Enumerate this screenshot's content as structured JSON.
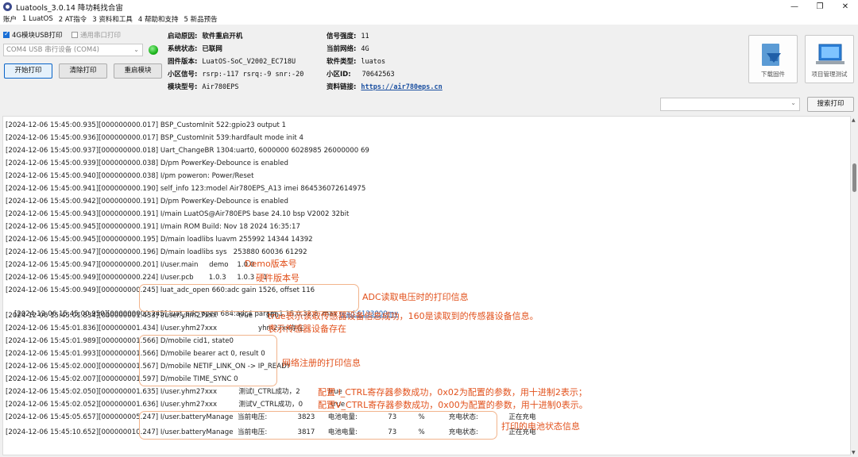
{
  "window": {
    "title": "Luatools_3.0.14 降功耗找合宙",
    "min_glyph": "—",
    "max_glyph": "❐",
    "close_glyph": "✕"
  },
  "menu": [
    "账户",
    "1 LuatOS",
    "2 AT指令",
    "3 资料和工具",
    "4 帮助和支持",
    "5 新品预告"
  ],
  "options": {
    "usb_print_label": "4G模块USB打印",
    "usb_print_checked": true,
    "serial_print_label": "通用串口打印",
    "serial_print_checked": false
  },
  "port_select": {
    "value": "COM4 USB 串行设备 (COM4)"
  },
  "led_color": "#1db41d",
  "buttons": {
    "start_print": "开始打印",
    "clear_print": "清除打印",
    "restart_module": "重启模块",
    "download_firmware": "下载固件",
    "project_test": "项目管理测试",
    "search_print": "搜索打印"
  },
  "device_info": {
    "boot_reason_label": "启动原因:",
    "boot_reason": "软件重启开机",
    "system_status_label": "系统状态:",
    "system_status": "已联网",
    "firmware_label": "固件版本:",
    "firmware": "LuatOS-SoC_V2002_EC718U",
    "cell_signal_label": "小区信号:",
    "cell_signal": "rsrp:-117 rsrq:-9 snr:-20",
    "module_model_label": "模块型号:",
    "module_model": "Air780EPS",
    "signal_label": "信号强度:",
    "signal": "11",
    "network_label": "当前网络:",
    "network": "4G",
    "sw_type_label": "软件类型:",
    "sw_type": "luatos",
    "cell_id_label": "小区ID:",
    "cell_id": "70642563",
    "docs_label": "资料链接:",
    "docs_link": "https://air780eps.cn"
  },
  "log": [
    "[2024-12-06 15:45:00.935][000000000.017] BSP_CustomInit 522:gpio23 output 1",
    "[2024-12-06 15:45:00.936][000000000.017] BSP_CustomInit 539:hardfault mode init 4",
    "[2024-12-06 15:45:00.937][000000000.018] Uart_ChangeBR 1304:uart0, 6000000 6028985 26000000 69",
    "[2024-12-06 15:45:00.939][000000000.038] D/pm PowerKey-Debounce is enabled",
    "[2024-12-06 15:45:00.940][000000000.038] I/pm poweron: Power/Reset",
    "[2024-12-06 15:45:00.941][000000000.190] self_info 123:model Air780EPS_A13 imei 864536072614975",
    "[2024-12-06 15:45:00.942][000000000.191] D/pm PowerKey-Debounce is enabled",
    "[2024-12-06 15:45:00.943][000000000.191] I/main LuatOS@Air780EPS base 24.10 bsp V2002 32bit",
    "[2024-12-06 15:45:00.945][000000000.191] I/main ROM Build: Nov 18 2024 16:35:17",
    "[2024-12-06 15:45:00.945][000000000.195] D/main loadlibs luavm 255992 14344 14392",
    "[2024-12-06 15:45:00.947][000000000.196] D/main loadlibs sys   253880 60036 61292",
    "[2024-12-06 15:45:00.947][000000000.201] I/user.main     demo    1.0.0",
    "[2024-12-06 15:45:00.949][000000000.224] I/user.pcb       1.0.3     1.0.3    1",
    "[2024-12-06 15:45:00.949][000000000.245] luat_adc_open 660:adc gain 1526, offset 116",
    "[2024-12-06 15:45:00.950][000000000.245] luat_adc_open 684:adc4 param 1,15,0,32,8, max ",
    "[2024-12-06 15:45:01.834][000000001.433] I/user.yhm27xxx          true      160",
    "[2024-12-06 15:45:01.836][000000001.434] I/user.yhm27xxx                   yhm27xx存在--",
    "[2024-12-06 15:45:01.989][000000001.566] D/mobile cid1, state0",
    "[2024-12-06 15:45:01.993][000000001.566] D/mobile bearer act 0, result 0",
    "[2024-12-06 15:45:02.000][000000001.567] D/mobile NETIF_LINK_ON -> IP_READY",
    "[2024-12-06 15:45:02.007][000000001.597] D/mobile TIME_SYNC 0",
    "[2024-12-06 15:45:02.050][000000001.635] I/user.yhm27xxx          测试I_CTRL成功，2             true",
    "[2024-12-06 15:45:02.052][000000001.636] I/user.yhm27xxx          测试V_CTRL成功，0             true",
    "[2024-12-06 15:45:05.657][000000005.247] I/user.batteryManage  当前电压:              3823      电池电量:              73          %           充电状态:              正在充电",
    "[2024-12-06 15:45:10.652][000000010.247] I/user.batteryManage  当前电压:              3817      电池电量:              73          %           充电状态:              正在充电"
  ],
  "adc_link": "read:6133000mv",
  "annotations": {
    "demo_version": "Demo版本号",
    "hw_version": "硬件版本号",
    "adc": "ADC读取电压时的打印信息",
    "sensor_read": "true表示读取传感器设备信息成功，160是读取到的传感器设备信息。",
    "sensor_exist": "表示传感器设备存在",
    "net_reg": "网络注册的打印信息",
    "i_ctrl": "配置 I_CTRL寄存器参数成功，0x02为配置的参数，用十进制2表示；",
    "v_ctrl": "配置V_CTRL寄存器参数成功，0x00为配置的参数，用十进制0表示。",
    "battery": "打印的电池状态信息"
  },
  "annotation_color": "#e2521d"
}
